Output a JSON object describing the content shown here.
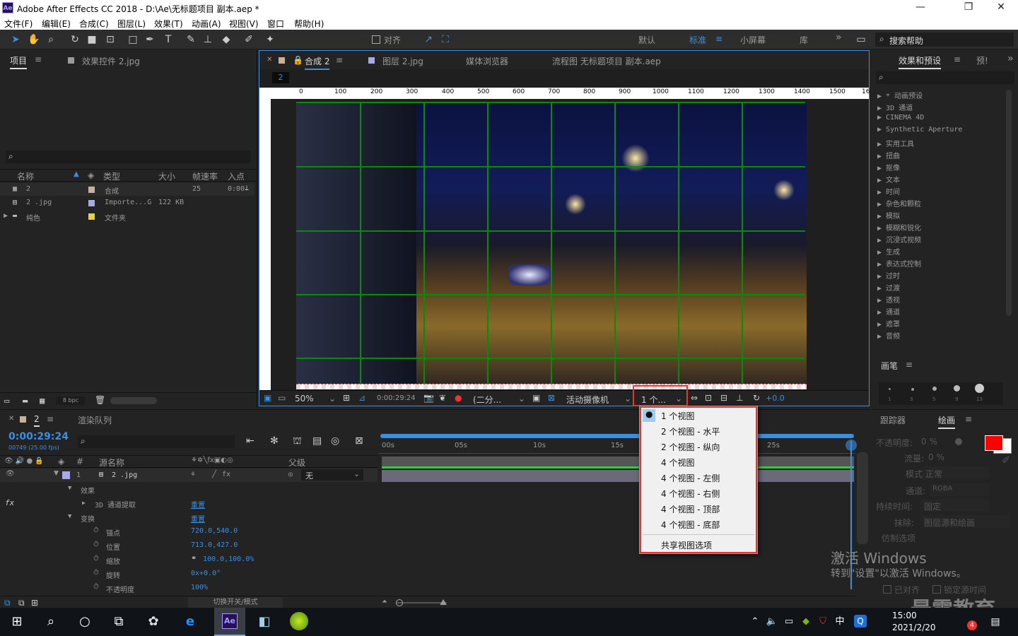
{
  "window": {
    "title": "Adobe After Effects CC 2018 - D:\\Ae\\无标题项目 副本.aep *",
    "ae_badge": "Ae",
    "min": "—",
    "max": "❐",
    "close": "✕"
  },
  "menu": [
    "文件(F)",
    "编辑(E)",
    "合成(C)",
    "图层(L)",
    "效果(T)",
    "动画(A)",
    "视图(V)",
    "窗口",
    "帮助(H)"
  ],
  "toolbar": {
    "align_label": "对齐",
    "workspaces": [
      "默认",
      "标准",
      "小屏幕",
      "库"
    ],
    "more": "»",
    "search_help": "搜索帮助"
  },
  "project_panel": {
    "tab_project": "项目",
    "tab_effect_controls": "效果控件 2.jpg",
    "columns": [
      "名称",
      "类型",
      "大小",
      "帧速率",
      "入点"
    ],
    "items": [
      {
        "name": "2",
        "type": "合成",
        "size": "",
        "fps": "25",
        "in": "0:00"
      },
      {
        "name": "2 .jpg",
        "type": "Importe...G",
        "size": "122 KB",
        "fps": "",
        "in": ""
      },
      {
        "name": "纯色",
        "type": "文件夹",
        "size": "",
        "fps": "",
        "in": ""
      }
    ],
    "bpc": "8 bpc"
  },
  "comp_panel": {
    "tabs": [
      "合成 2",
      "图层 2.jpg",
      "媒体浏览器",
      "流程图 无标题项目 副本.aep"
    ],
    "breadcrumb": "2",
    "ruler": [
      "0",
      "100",
      "200",
      "300",
      "400",
      "500",
      "600",
      "700",
      "800",
      "900",
      "1000",
      "1100",
      "1200",
      "1300",
      "1400",
      "1500",
      "16"
    ],
    "zoom": "50%",
    "timecode": "0:00:29:24",
    "resolution": "(二分...",
    "camera": "活动摄像机",
    "views": "1 个...",
    "exposure": "+0.0"
  },
  "view_menu": {
    "items": [
      "1 个视图",
      "2 个视图 - 水平",
      "2 个视图 - 纵向",
      "4 个视图",
      "4 个视图 - 左侧",
      "4 个视图 - 右侧",
      "4 个视图 - 顶部",
      "4 个视图 - 底部"
    ],
    "shared": "共享视图选项",
    "selected_index": 0
  },
  "effects_panel": {
    "tab": "效果和预设",
    "tab2": "预!",
    "items": [
      "* 动画预设",
      "3D 通道",
      "CINEMA 4D",
      "Synthetic Aperture",
      "实用工具",
      "扭曲",
      "抠像",
      "文本",
      "时间",
      "杂色和颗粒",
      "模拟",
      "模糊和锐化",
      "沉浸式视频",
      "生成",
      "表达式控制",
      "过时",
      "过渡",
      "透视",
      "通道",
      "遮罩",
      "音频"
    ]
  },
  "brush_panel": {
    "tab": "画笔",
    "sizes": [
      "1",
      "3",
      "5",
      "9",
      "13"
    ]
  },
  "paint_panel": {
    "tab_tracker": "跟踪器",
    "tab_paint": "绘画",
    "opacity_label": "不透明度:",
    "opacity": "0 %",
    "flow_label": "流量:",
    "flow": "0 %",
    "mode_label": "模式:",
    "mode": "正常",
    "channel_label": "通道:",
    "channel": "RGBA",
    "duration_label": "持续时间:",
    "duration": "固定",
    "erase_label": "抹除:",
    "erase": "图层源和绘画",
    "clone_label": "仿制选项",
    "aligned": "已对齐",
    "lock_source": "锁定源时间",
    "accent": "#ff0000"
  },
  "timeline": {
    "tab_comp": "2",
    "tab_render": "渲染队列",
    "timecode": "0:00:29:24",
    "frames": "00749 (25.00 fps)",
    "col_source": "源名称",
    "col_parent": "父级",
    "layer_num": "1",
    "layer_name": "2 .jpg",
    "parent": "无",
    "props": [
      {
        "name": "效果",
        "value": ""
      },
      {
        "name": "3D 通道提取",
        "value": "重置"
      },
      {
        "name": "变换",
        "value": "重置"
      },
      {
        "name": "锚点",
        "value": "720.0,540.0"
      },
      {
        "name": "位置",
        "value": "713.0,427.0"
      },
      {
        "name": "缩放",
        "value": "100.0,100.0%"
      },
      {
        "name": "旋转",
        "value": "0x+0.0°"
      },
      {
        "name": "不透明度",
        "value": "100%"
      }
    ],
    "fx": "fx",
    "ruler": [
      "00s",
      "05s",
      "10s",
      "15s",
      "25s"
    ],
    "toggle": "切换开关/模式"
  },
  "watermark": {
    "line1": "激活 Windows",
    "line2": "转到\"设置\"以激活 Windows。",
    "brand": "最需教育"
  },
  "taskbar": {
    "time": "15:00",
    "date": "2021/2/20",
    "ime": "中",
    "badge": "4"
  }
}
